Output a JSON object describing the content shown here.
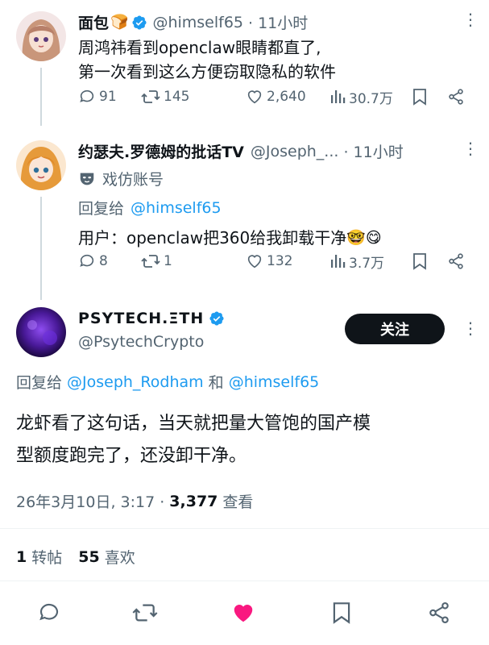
{
  "tweet1": {
    "name": "面包",
    "emoji": "🍞",
    "handle": "@himself65",
    "time": "· 11小时",
    "lines": [
      "周鸿祎看到openclaw眼睛都直了,",
      "第一次看到这么方便窃取隐私的软件"
    ],
    "replies": "91",
    "retweets": "145",
    "likes": "2,640",
    "views": "30.7万"
  },
  "tweet2": {
    "name": "约瑟夫.罗德姆的批话TV",
    "handle": "@Joseph_...",
    "time": "· 11小时",
    "badge": "戏仿账号",
    "reply_prefix": "回复给",
    "reply_to": "@himself65",
    "text": "用户：openclaw把360给我卸载干净",
    "emojis": "🤓😋",
    "replies": "8",
    "retweets": "1",
    "likes": "132",
    "views": "3.7万"
  },
  "tweet3": {
    "name": "PSYTECH.ΞTH",
    "handle": "@PsytechCrypto",
    "follow_label": "关注",
    "reply_prefix": "回复给",
    "reply_to_1": "@Joseph_Rodham",
    "reply_and": "和",
    "reply_to_2": "@himself65",
    "lines": [
      "龙虾看了这句话，当天就把量大管饱的国产模",
      "型额度跑完了，还没卸干净。"
    ],
    "timestamp": "26年3月10日, 3:17 ·",
    "view_count": "3,377",
    "view_label": "查看",
    "reposts_count": "1",
    "reposts_label": "转帖",
    "likes_count": "55",
    "likes_label": "喜欢"
  },
  "colors": {
    "verified": "#1d9bf0",
    "like_active": "#f91880",
    "follow_bg": "#0f1419"
  }
}
